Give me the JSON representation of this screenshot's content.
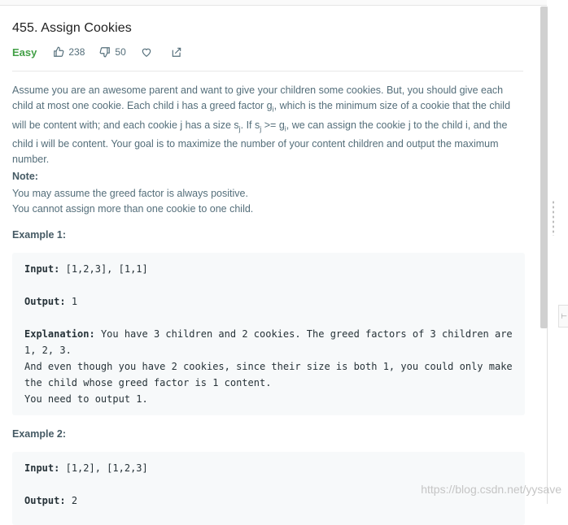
{
  "problem": {
    "title": "455. Assign Cookies",
    "difficulty": "Easy",
    "likes": "238",
    "dislikes": "50"
  },
  "description": {
    "p1": "Assume you are an awesome parent and want to give your children some cookies. But, you should give each child at most one cookie. Each child i has a greed factor ",
    "g": "g",
    "sub_i": "i",
    "p2": ", which is the minimum size of a cookie that the child will be content with; and each cookie j has a size ",
    "s": "s",
    "sub_j": "j",
    "p3": ". If ",
    "s2": "s",
    "sub_j2": "j",
    "p4": " >= ",
    "g2": "g",
    "sub_i2": "i",
    "p5": ", we can assign the cookie j to the child i, and the child i will be content. Your goal is to maximize the number of your content children and output the maximum number."
  },
  "note": {
    "title": "Note:",
    "line1": "You may assume the greed factor is always positive.",
    "line2": "You cannot assign more than one cookie to one child."
  },
  "example1": {
    "title": "Example 1:",
    "input_label": "Input:",
    "input": "[1,2,3], [1,1]",
    "output_label": "Output:",
    "output": "1",
    "explanation_label": "Explanation:",
    "explanation": "You have 3 children and 2 cookies. The greed factors of 3 children are 1, 2, 3.\nAnd even though you have 2 cookies, since their size is both 1, you could only make the child whose greed factor is 1 content.\nYou need to output 1."
  },
  "example2": {
    "title": "Example 2:",
    "input_label": "Input:",
    "input": "[1,2], [1,2,3]",
    "output_label": "Output:",
    "output": "2"
  },
  "side_tab_glyph": "⊢",
  "watermark": "https://blog.csdn.net/yysave"
}
